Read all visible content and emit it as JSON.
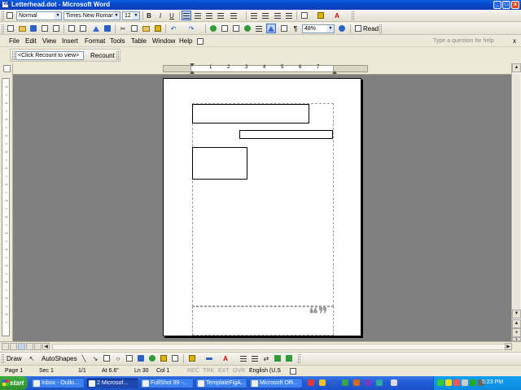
{
  "window": {
    "title": "Letterhead.dot - Microsoft Word",
    "minimize": "_",
    "maximize": "□",
    "close": "x"
  },
  "formatting": {
    "style": "Normal",
    "font": "Times New Roman",
    "size": "12",
    "bold": "B",
    "italic": "I",
    "underline": "U"
  },
  "standard": {
    "zoom": "48%",
    "read_label": "Read"
  },
  "menu": {
    "items": [
      "File",
      "Edit",
      "View",
      "Insert",
      "Format",
      "Tools",
      "Table",
      "Window",
      "Help"
    ],
    "help_box_placeholder": "Type a question for help"
  },
  "reviewing": {
    "display": "<Click Recount to view>",
    "recount_label": "Recount"
  },
  "ruler": {
    "numbers": [
      "1",
      "2",
      "3",
      "4",
      "5",
      "6",
      "7"
    ]
  },
  "drawing": {
    "draw_label": "Draw",
    "autoshapes_label": "AutoShapes"
  },
  "status": {
    "page": "Page 1",
    "section": "Sec 1",
    "pages": "1/1",
    "at": "At 6.6\"",
    "line": "Ln 30",
    "col": "Col 1",
    "rec": "REC",
    "trk": "TRK",
    "ext": "EXT",
    "ovr": "OVR",
    "language": "English (U.S"
  },
  "taskbar": {
    "start": "start",
    "tasks": [
      {
        "label": "Inbox - Outlo...",
        "active": false
      },
      {
        "label": "2 Microsof...",
        "active": true
      },
      {
        "label": "FullShot 99 -...",
        "active": false
      },
      {
        "label": "TemplateFigA...",
        "active": false
      },
      {
        "label": "Microsoft Offi...",
        "active": false
      }
    ],
    "clock": "5:23 PM"
  }
}
